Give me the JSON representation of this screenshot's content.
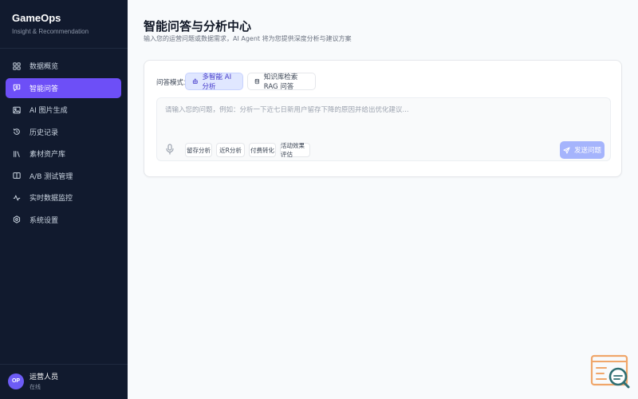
{
  "sidebar": {
    "brand_title": "GameOps",
    "brand_subtitle": "Insight & Recommendation",
    "items": [
      {
        "label": "数据概览",
        "icon": "grid-icon",
        "active": false
      },
      {
        "label": "智能问答",
        "icon": "chat-icon",
        "active": true
      },
      {
        "label": "AI 图片生成",
        "icon": "image-icon",
        "active": false
      },
      {
        "label": "历史记录",
        "icon": "history-icon",
        "active": false
      },
      {
        "label": "素材资产库",
        "icon": "library-icon",
        "active": false
      },
      {
        "label": "A/B 测试管理",
        "icon": "ab-test-icon",
        "active": false
      },
      {
        "label": "实时数据监控",
        "icon": "activity-icon",
        "active": false
      },
      {
        "label": "系统设置",
        "icon": "settings-icon",
        "active": false
      }
    ],
    "user": {
      "avatar": "OP",
      "name": "运营人员",
      "role": "在线"
    }
  },
  "main": {
    "title": "智能问答与分析中心",
    "subtitle": "输入您的运营问题或数据需求，AI Agent 将为您提供深度分析与建议方案",
    "mode_label": "问答模式：",
    "modes": [
      {
        "label": "多智能 AI 分析",
        "icon": "robot-icon",
        "active": true
      },
      {
        "label": "知识库检索 RAG 问答",
        "icon": "database-icon",
        "active": false
      }
    ],
    "input_placeholder": "请输入您的问题，例如：分析一下近七日新用户留存下降的原因并给出优化建议...",
    "chips": [
      "留存分析",
      "近R分析",
      "付费转化",
      "活动效果评估"
    ],
    "send_label": "发送问题"
  },
  "colors": {
    "sidebar_bg": "#111a2e",
    "accent": "#6d4ff7",
    "send_disabled": "#a5b4fc",
    "widget_orange": "#f0a66a",
    "widget_teal": "#2f6f73"
  }
}
